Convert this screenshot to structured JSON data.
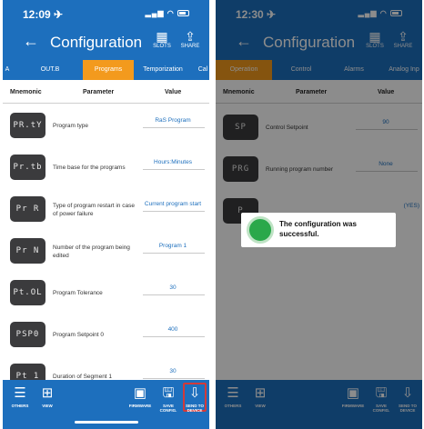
{
  "left": {
    "status": {
      "time": "12:09 ✈",
      "icons": "▂▄▆ ◠"
    },
    "appbar": {
      "title": "Configuration",
      "slots": "SLOTS",
      "share": "SHARE"
    },
    "tabs": [
      {
        "label": "A"
      },
      {
        "label": "OUT.B"
      },
      {
        "label": "Programs"
      },
      {
        "label": "Temporization"
      },
      {
        "label": "Cal"
      }
    ],
    "table_header": {
      "mnemonic": "Mnemonic",
      "parameter": "Parameter",
      "value": "Value"
    },
    "rows": [
      {
        "mnemonic": "PR.tY",
        "parameter": "Program type",
        "value": "RaS Program"
      },
      {
        "mnemonic": "Pr.tb",
        "parameter": "Time base for the programs",
        "value": "Hours:Minutes"
      },
      {
        "mnemonic": "Pr R",
        "parameter": "Type of program restart in case of power failure",
        "value": "Current program start"
      },
      {
        "mnemonic": "Pr N",
        "parameter": "Number of the program being edited",
        "value": "Program 1"
      },
      {
        "mnemonic": "Pt.OL",
        "parameter": "Program Tolerance",
        "value": "30"
      },
      {
        "mnemonic": "PSP0",
        "parameter": "Program Setpoint 0",
        "value": "400"
      },
      {
        "mnemonic": "Pt 1",
        "parameter": "Duration of Segment 1",
        "value": "30"
      }
    ],
    "bottom": {
      "others": "OTHERS",
      "view": "VIEW",
      "firmware": "FIRMWARE",
      "save_config": "SAVE CONFIG.",
      "send_to_device": "SEND TO DEVICE"
    }
  },
  "right": {
    "status": {
      "time": "12:30 ✈",
      "icons": "▂▄▆ ◠"
    },
    "appbar": {
      "title": "Configuration",
      "slots": "SLOTS",
      "share": "SHARE"
    },
    "tabs": [
      {
        "label": "Operation"
      },
      {
        "label": "Control"
      },
      {
        "label": "Alarms"
      },
      {
        "label": "Analog Inp"
      }
    ],
    "table_header": {
      "mnemonic": "Mnemonic",
      "parameter": "Parameter",
      "value": "Value"
    },
    "rows": [
      {
        "mnemonic": "SP",
        "parameter": "Control Setpoint",
        "value": "90"
      },
      {
        "mnemonic": "PRG",
        "parameter": "Running program number",
        "value": "None"
      },
      {
        "mnemonic": "P",
        "parameter": "",
        "value": "(YES)"
      }
    ],
    "toast": {
      "message": "The configuration was successful."
    },
    "bottom": {
      "others": "OTHERS",
      "view": "VIEW",
      "firmware": "FIRMWARE",
      "save_config": "SAVE CONFIG.",
      "send_to_device": "SEND TO DEVICE"
    }
  },
  "colors": {
    "primary": "#1d6fbd",
    "active_tab": "#f39a1d",
    "chip": "#3b3b3d",
    "highlight": "#d23a3a",
    "success": "#2aa84a"
  }
}
